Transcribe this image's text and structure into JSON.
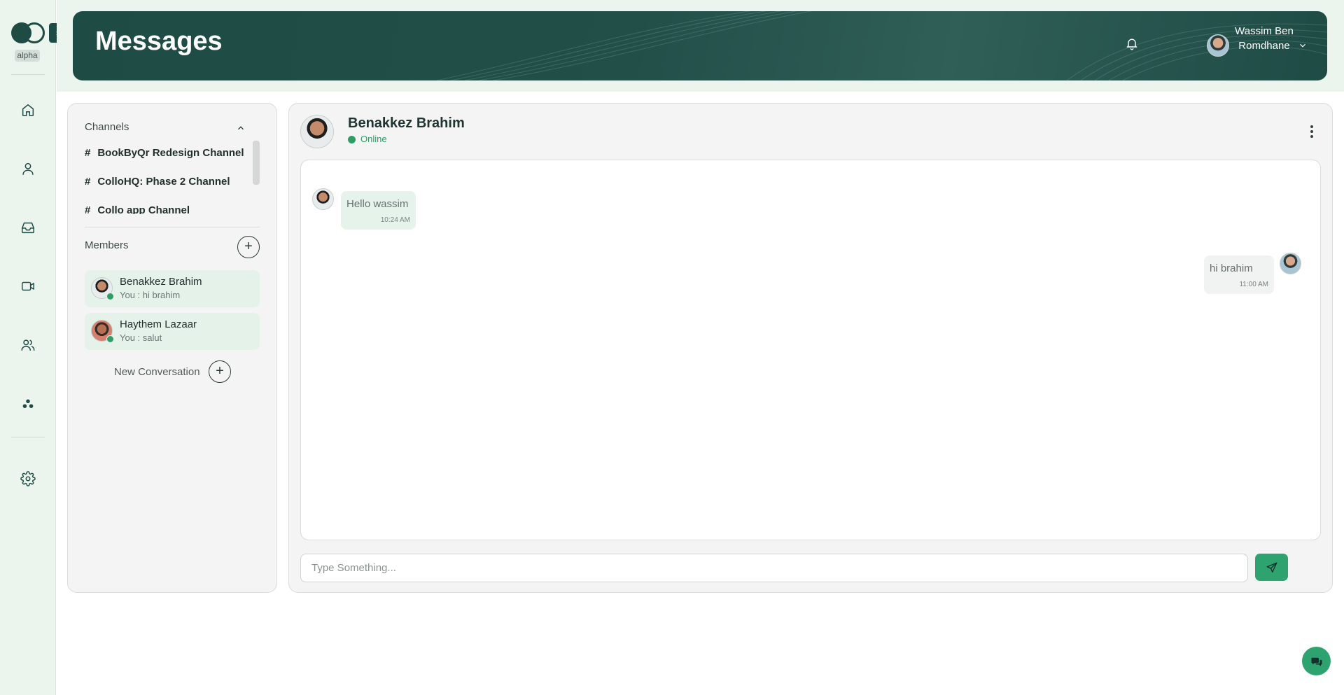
{
  "app": {
    "logo_badge": "alpha",
    "expand_label": "›"
  },
  "header": {
    "title": "Messages",
    "user_name": "Wassim Ben Romdhane"
  },
  "nav": {
    "items": [
      "home-icon",
      "user-icon",
      "inbox-icon",
      "video-icon",
      "team-icon",
      "apps-icon",
      "gear-icon"
    ]
  },
  "channels": {
    "title": "Channels",
    "items": [
      {
        "label": "BookByQr Redesign Channel"
      },
      {
        "label": "ColloHQ: Phase 2 Channel"
      },
      {
        "label": "Collo app Channel"
      }
    ]
  },
  "members": {
    "title": "Members",
    "add_label": "+",
    "items": [
      {
        "name": "Benakkez Brahim",
        "preview": "You : hi brahim",
        "status": "online"
      },
      {
        "name": "Haythem Lazaar",
        "preview": "You : salut",
        "status": "online"
      }
    ],
    "new_conversation_label": "New Conversation",
    "new_conversation_plus": "+"
  },
  "chat": {
    "contact_name": "Benakkez Brahim",
    "status": "Online",
    "messages": [
      {
        "direction": "incoming",
        "text": "Hello wassim",
        "time": "10:24 AM"
      },
      {
        "direction": "outgoing",
        "text": "hi brahim",
        "time": "11:00 AM"
      }
    ],
    "composer": {
      "placeholder": "Type Something...",
      "value": ""
    }
  },
  "colors": {
    "brand_dark": "#1f4b45",
    "accent_green": "#2ea36f",
    "online": "#2e9e66",
    "rail_bg": "#ebf5ee"
  }
}
